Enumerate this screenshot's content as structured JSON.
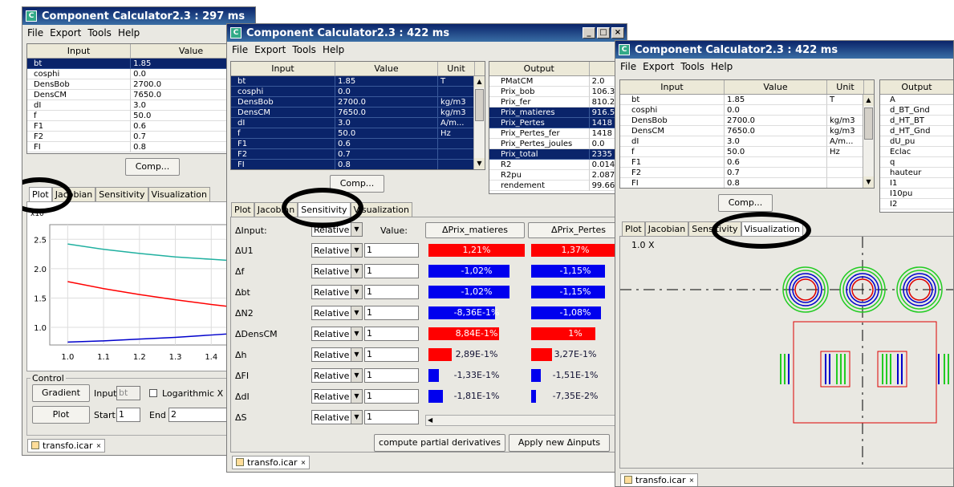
{
  "windows": [
    {
      "title": "Component Calculator2.3 : 297 ms"
    },
    {
      "title": "Component Calculator2.3 : 422 ms"
    },
    {
      "title": "Component Calculator2.3 : 422 ms"
    }
  ],
  "menu": [
    "File",
    "Export",
    "Tools",
    "Help"
  ],
  "headers": {
    "input": "Input",
    "value": "Value",
    "unit": "Unit",
    "output": "Output"
  },
  "inputs": [
    {
      "name": "bt",
      "value": "1.85",
      "unit": "T"
    },
    {
      "name": "cosphi",
      "value": "0.0",
      "unit": ""
    },
    {
      "name": "DensBob",
      "value": "2700.0",
      "unit": "kg/m3"
    },
    {
      "name": "DensCM",
      "value": "7650.0",
      "unit": "kg/m3"
    },
    {
      "name": "dI",
      "value": "3.0",
      "unit": "A/m..."
    },
    {
      "name": "f",
      "value": "50.0",
      "unit": "Hz"
    },
    {
      "name": "F1",
      "value": "0.6",
      "unit": ""
    },
    {
      "name": "F2",
      "value": "0.7",
      "unit": ""
    },
    {
      "name": "FI",
      "value": "0.8",
      "unit": ""
    }
  ],
  "outputs_w2": [
    {
      "name": "PMatCM",
      "value": "2.0"
    },
    {
      "name": "Prix_bob",
      "value": "106.3"
    },
    {
      "name": "Prix_fer",
      "value": "810.2"
    },
    {
      "name": "Prix_matieres",
      "value": "916.5"
    },
    {
      "name": "Prix_Pertes",
      "value": "1418"
    },
    {
      "name": "Prix_Pertes_fer",
      "value": "1418"
    },
    {
      "name": "Prix_Pertes_joules",
      "value": "0.0"
    },
    {
      "name": "Prix_total",
      "value": "2335"
    },
    {
      "name": "R2",
      "value": "0.014"
    },
    {
      "name": "R2pu",
      "value": "2.087"
    },
    {
      "name": "rendement",
      "value": "99.66"
    }
  ],
  "outputs_w3": [
    "A",
    "d_BT_Gnd",
    "d_HT_BT",
    "d_HT_Gnd",
    "dU_pu",
    "Eclac",
    "q",
    "hauteur",
    "I1",
    "I10pu",
    "I2"
  ],
  "comp_label": "Comp...",
  "tabs": [
    "Plot",
    "Jacobian",
    "Sensitivity",
    "Visualization"
  ],
  "w1_tabs_labels": {
    "plot": "Plot",
    "jacobian": "Jacobian",
    "sensitivity": "Sensitivity",
    "visualization": "Visualization"
  },
  "plot": {
    "y_ticks": [
      "2.5",
      "2.0",
      "1.5",
      "1.0"
    ],
    "x_ticks": [
      "1.0",
      "1.1",
      "1.2",
      "1.3",
      "1.4"
    ],
    "y_exp": "x10"
  },
  "chart_data": {
    "type": "line",
    "x": [
      1.0,
      1.1,
      1.2,
      1.3,
      1.4,
      1.5
    ],
    "series": [
      {
        "values": [
          2.42,
          2.33,
          2.26,
          2.2,
          2.16,
          2.12
        ],
        "color": "#20b0a0"
      },
      {
        "values": [
          1.78,
          1.66,
          1.56,
          1.47,
          1.39,
          1.32
        ],
        "color": "#ff0000"
      },
      {
        "values": [
          0.75,
          0.77,
          0.8,
          0.83,
          0.87,
          0.91
        ],
        "color": "#0000cc"
      }
    ],
    "xlim": [
      0.95,
      1.5
    ],
    "ylim": [
      0.7,
      2.75
    ]
  },
  "control": {
    "label": "Control",
    "gradient": "Gradient",
    "input_label": "Input",
    "input_value": "bt",
    "log_label": "Logarithmic X P",
    "plot_btn": "Plot",
    "start_label": "Start",
    "start_value": "1",
    "end_label": "End",
    "end_value": "2"
  },
  "sensitivity": {
    "dinput_label": "ΔInput:",
    "relative": "Relative",
    "value_label": "Value:",
    "col1": "ΔPrix_matieres",
    "col2": "ΔPrix_Pertes",
    "rows": [
      {
        "name": "ΔU1",
        "value": "1",
        "a": "1,21%",
        "b": "1,37%",
        "a_frac": 1.0,
        "b_frac": 1.0,
        "a_color": "#ff0000",
        "b_color": "#ff0000"
      },
      {
        "name": "Δf",
        "value": "1",
        "a": "-1,02%",
        "b": "-1,15%",
        "a_frac": 0.84,
        "b_frac": 0.84,
        "a_color": "#0000ee",
        "b_color": "#0000ee"
      },
      {
        "name": "Δbt",
        "value": "1",
        "a": "-1,02%",
        "b": "-1,15%",
        "a_frac": 0.84,
        "b_frac": 0.84,
        "a_color": "#0000ee",
        "b_color": "#0000ee"
      },
      {
        "name": "ΔN2",
        "value": "1",
        "a": "-8,36E-1%",
        "b": "-1,08%",
        "a_frac": 0.69,
        "b_frac": 0.79,
        "a_color": "#0000ee",
        "b_color": "#0000ee"
      },
      {
        "name": "ΔDensCM",
        "value": "1",
        "a": "8,84E-1%",
        "b": "1%",
        "a_frac": 0.73,
        "b_frac": 0.73,
        "a_color": "#ff0000",
        "b_color": "#ff0000"
      },
      {
        "name": "Δh",
        "value": "1",
        "a": "2,89E-1%",
        "b": "3,27E-1%",
        "a_frac": 0.24,
        "b_frac": 0.24,
        "a_color": "#ff0000",
        "b_color": "#ff0000"
      },
      {
        "name": "ΔFI",
        "value": "1",
        "a": "-1,33E-1%",
        "b": "-1,51E-1%",
        "a_frac": 0.11,
        "b_frac": 0.11,
        "a_color": "#0000ee",
        "b_color": "#0000ee"
      },
      {
        "name": "ΔdI",
        "value": "1",
        "a": "-1,81E-1%",
        "b": "-7,35E-2%",
        "a_frac": 0.15,
        "b_frac": 0.05,
        "a_color": "#0000ee",
        "b_color": "#0000ee"
      },
      {
        "name": "ΔS",
        "value": "1",
        "a": "",
        "b": "",
        "a_frac": 0,
        "b_frac": 0,
        "a_color": "#0000ee",
        "b_color": "#0000ee"
      }
    ],
    "compute": "compute partial derivatives",
    "apply": "Apply new Δinputs"
  },
  "viz": {
    "zoom": "1.0 X"
  },
  "file_tab": "transfo.icar"
}
